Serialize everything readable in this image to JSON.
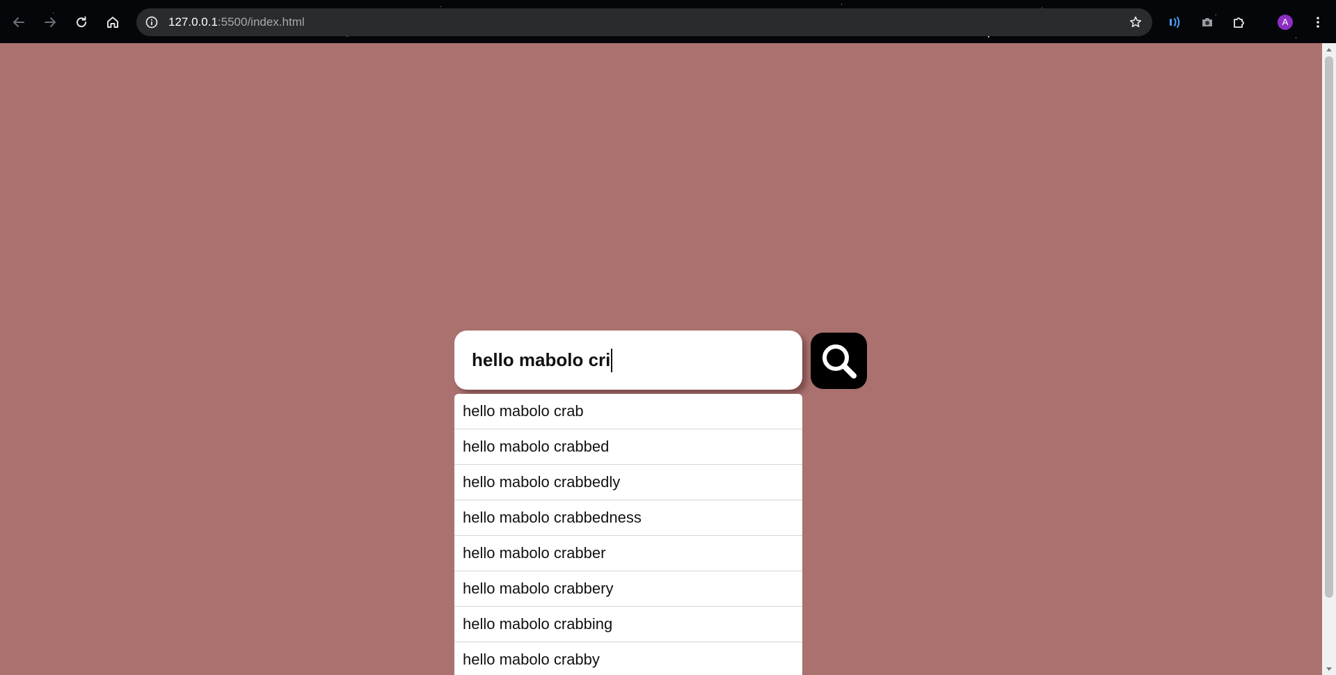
{
  "browser": {
    "url_host": "127.0.0.1",
    "url_rest": ":5500/index.html",
    "avatar_letter": "A",
    "icons": {
      "back": "arrow-left-icon",
      "forward": "arrow-right-icon",
      "reload": "reload-icon",
      "home": "home-icon",
      "site_info": "info-icon",
      "bookmark": "star-icon",
      "read_aloud": "read-aloud-icon",
      "screenshot": "camera-icon",
      "extensions": "puzzle-icon",
      "menu": "kebab-menu-icon"
    },
    "colors": {
      "toolbar": "#05060a",
      "omnibox": "#2a2b2f",
      "avatar": "#8e2ec4",
      "read_aloud_accent": "#4da3ff"
    }
  },
  "page": {
    "background_color": "#aa716f",
    "search": {
      "value": "hello mabolo cri",
      "button_icon": "search-icon"
    },
    "suggestions": [
      "hello mabolo crab",
      "hello mabolo crabbed",
      "hello mabolo crabbedly",
      "hello mabolo crabbedness",
      "hello mabolo crabber",
      "hello mabolo crabbery",
      "hello mabolo crabbing",
      "hello mabolo crabby"
    ]
  }
}
